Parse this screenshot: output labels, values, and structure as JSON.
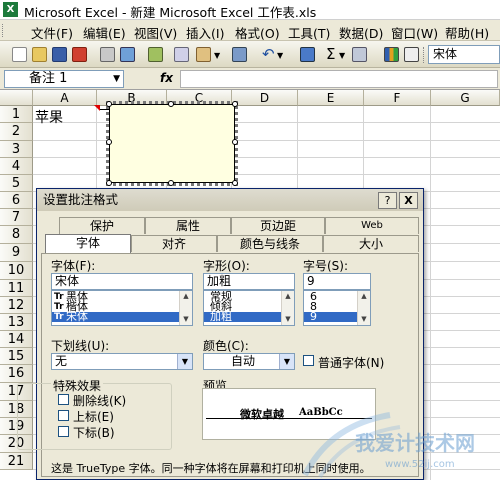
{
  "window": {
    "title": "Microsoft Excel - 新建 Microsoft Excel 工作表.xls",
    "app_icon": "X"
  },
  "menubar": {
    "items": [
      "文件(F)",
      "编辑(E)",
      "视图(V)",
      "插入(I)",
      "格式(O)",
      "工具(T)",
      "数据(D)",
      "窗口(W)",
      "帮助(H)"
    ]
  },
  "toolbar": {
    "font_name": "宋体",
    "sigma": "Σ"
  },
  "formula_bar": {
    "name_box": "备注 1",
    "fx": "fx",
    "content": ""
  },
  "grid": {
    "columns": [
      "A",
      "B",
      "C",
      "D",
      "E",
      "F",
      "G"
    ],
    "rows": [
      "1",
      "2",
      "3",
      "4",
      "5",
      "6",
      "7",
      "8",
      "9",
      "10",
      "11",
      "12",
      "13",
      "14",
      "15",
      "16",
      "17",
      "18",
      "19",
      "20",
      "21"
    ],
    "cell_A1": "苹果"
  },
  "dialog": {
    "title": "设置批注格式",
    "help_btn": "?",
    "close_btn": "X",
    "tabs_back": [
      "保护",
      "属性",
      "页边距",
      "Web"
    ],
    "tabs_front": [
      "字体",
      "对齐",
      "颜色与线条",
      "大小"
    ],
    "active_tab": "字体",
    "font": {
      "label": "字体(F):",
      "value": "宋体",
      "list": [
        "黑体",
        "楷体",
        "宋体"
      ],
      "selected": "宋体"
    },
    "style": {
      "label": "字形(O):",
      "value": "加粗",
      "list": [
        "常规",
        "倾斜",
        "加粗"
      ],
      "selected": "加粗"
    },
    "size": {
      "label": "字号(S):",
      "value": "9",
      "list": [
        "6",
        "8",
        "9"
      ],
      "selected": "9"
    },
    "underline": {
      "label": "下划线(U):",
      "value": "无"
    },
    "color": {
      "label": "颜色(C):",
      "value": "自动"
    },
    "normal_font": {
      "label": "普通字体(N)",
      "checked": false
    },
    "effects": {
      "label": "特殊效果",
      "strikethrough": "删除线(K)",
      "superscript": "上标(E)",
      "subscript": "下标(B)"
    },
    "preview": {
      "label": "预览",
      "sample_cn": "微软卓越",
      "sample_en": "AaBbCc"
    },
    "footer": "这是 TrueType 字体。同一种字体将在屏幕和打印机上同时使用。"
  },
  "watermark": {
    "text": "我爱计技术网",
    "url": "www.52ij.com"
  },
  "colors": {
    "selection": "#316ac5",
    "comment_bg": "#ffffe1",
    "dialog_bg": "#ece9d8",
    "xl_green": "#1d7a3c"
  }
}
